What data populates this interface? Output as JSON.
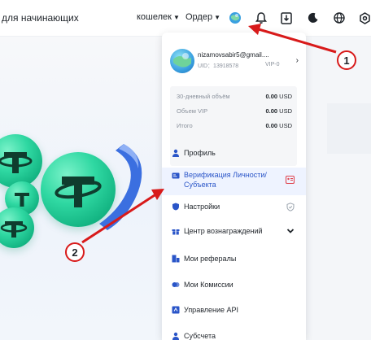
{
  "header": {
    "brand_text": "для начинающих",
    "wallet_label": "кошелек",
    "order_label": "Ордер"
  },
  "account": {
    "email": "nizamovsabir5@gmail....",
    "uid": "UID：13918578",
    "vip": "VIP-0"
  },
  "stats": [
    {
      "label": "30-дневный объём",
      "value": "0.00",
      "unit": "USD"
    },
    {
      "label": "Объем VIP",
      "value": "0.00",
      "unit": "USD"
    },
    {
      "label": "Итого",
      "value": "0.00",
      "unit": "USD"
    }
  ],
  "menu": {
    "profile": "Профиль",
    "verification": "Верификация Личности/ Субъекта",
    "settings": "Настройки",
    "rewards": "Центр вознаграждений",
    "referrals": "Мои рефералы",
    "commissions": "Мои Комиссии",
    "api": "Управление API",
    "subaccounts": "Субсчета"
  },
  "callouts": [
    "1",
    "2"
  ],
  "colors": {
    "accent": "#2a55c8",
    "callout_red": "#d81a1a",
    "coin_green": "#2fd8a2",
    "active_bg": "#eef3ff"
  }
}
